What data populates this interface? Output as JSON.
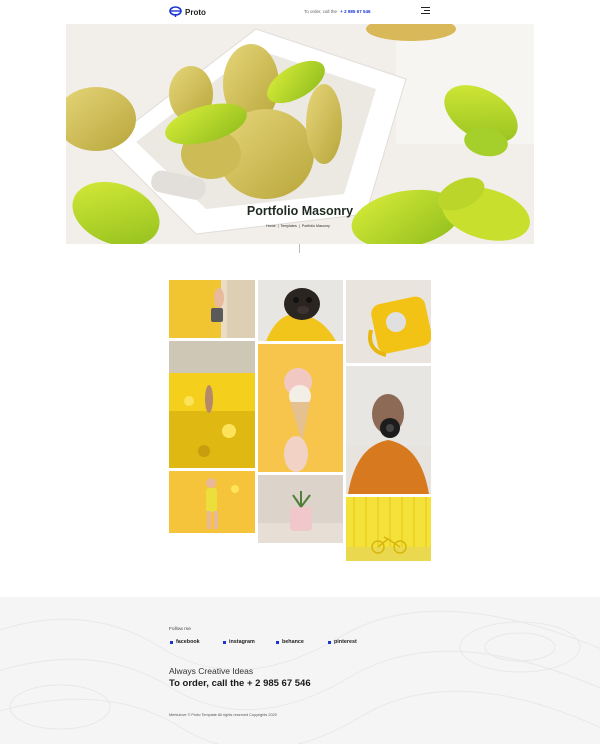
{
  "header": {
    "brand": "Proto",
    "order_prefix": "To order, call the",
    "order_phone": "+ 2 985 67 546",
    "menu_icon": "hamburger-menu-icon"
  },
  "hero": {
    "title": "Portfolio Masonry",
    "breadcrumb": [
      "Home",
      "|",
      "Templates",
      "|",
      "Portfolio Masonry"
    ],
    "image": "pears-in-white-tray-with-green-leaves"
  },
  "gallery": {
    "items": [
      {
        "subject": "yellow-background-hand-with-camera"
      },
      {
        "subject": "pug-with-yellow-hood"
      },
      {
        "subject": "yellow-retro-telephone"
      },
      {
        "subject": "woman-in-rapeseed-field"
      },
      {
        "subject": "hand-holding-ice-cream-cone"
      },
      {
        "subject": "person-holding-camera-lens"
      },
      {
        "subject": "woman-in-yellow-outfit"
      },
      {
        "subject": "cactus-in-pink-pot"
      },
      {
        "subject": "yellow-bicycle-yellow-wall"
      }
    ]
  },
  "footer": {
    "follow_label": "Follow me",
    "social": [
      "facebook",
      "instagram",
      "behance",
      "pinterest"
    ],
    "tagline": "Always Creative Ideas",
    "order_line": "To order, call the + 2 985 67 546",
    "copyright": "Merkulove © Proto Template All rights reserved Copyrights 2020"
  },
  "colors": {
    "accent": "#1a35d6",
    "tile_yellow": "#f3c12a",
    "footer_bg": "#f5f5f5"
  }
}
